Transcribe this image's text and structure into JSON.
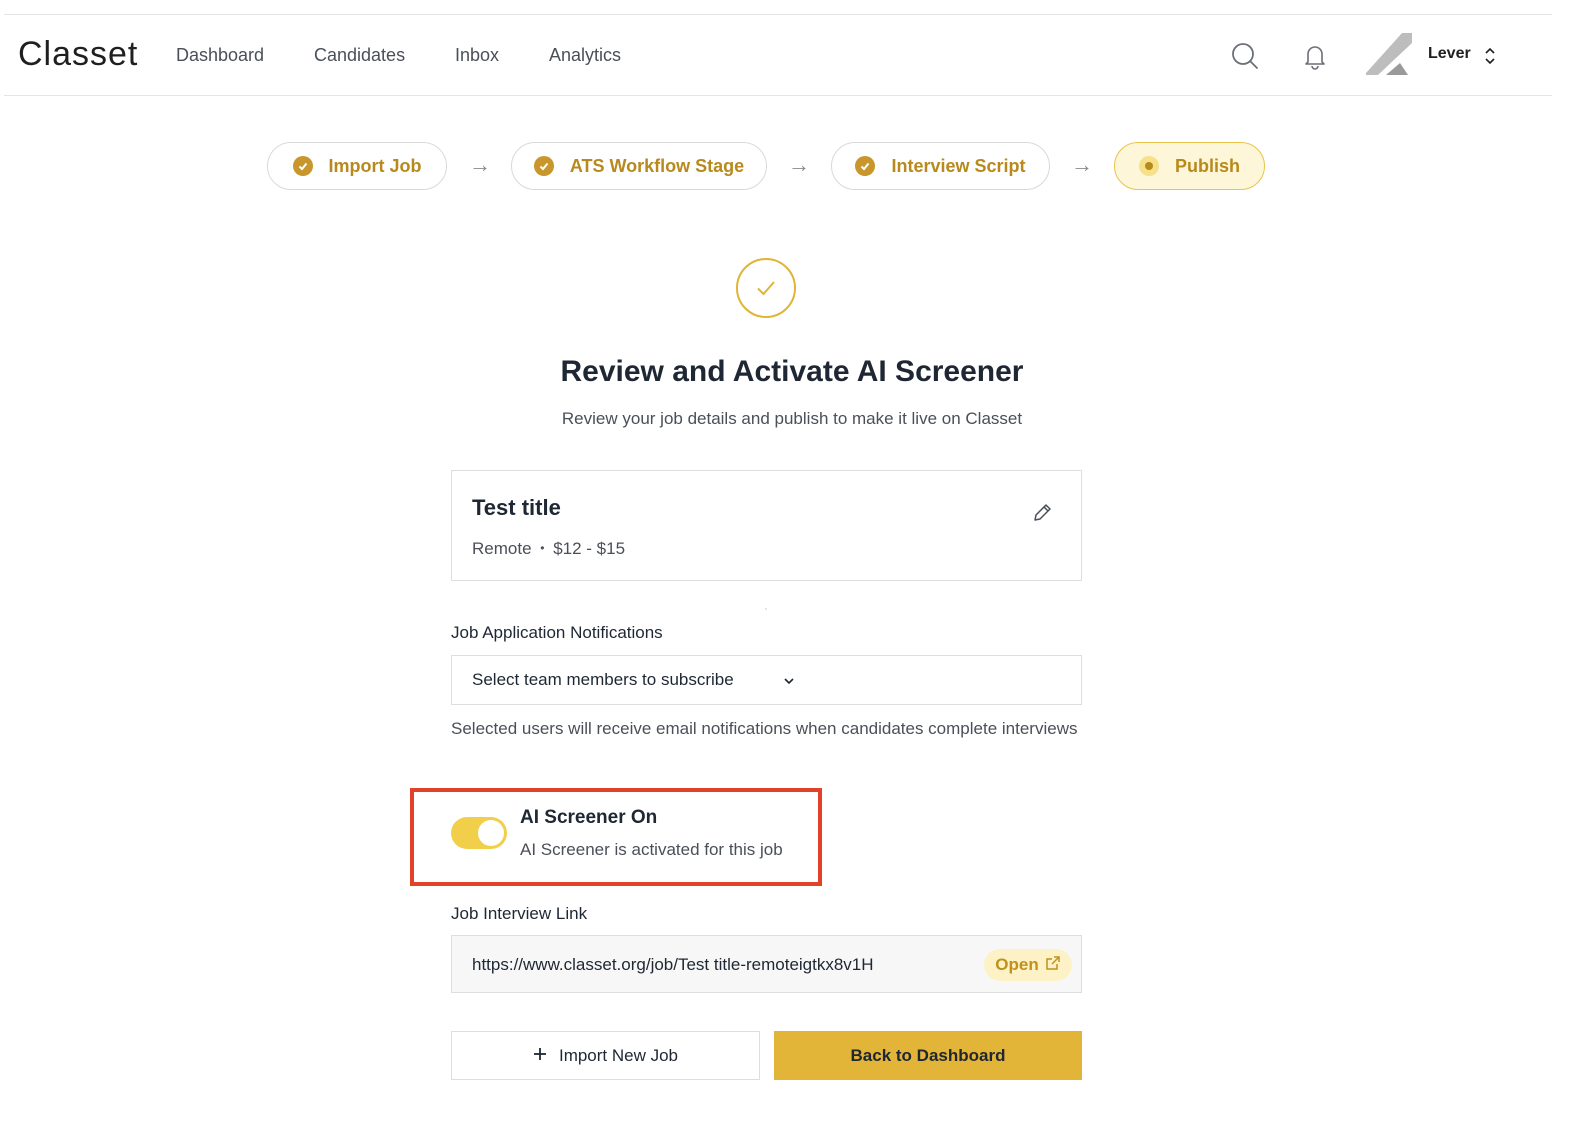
{
  "brand": {
    "logo_text": "Classet"
  },
  "nav": {
    "items": [
      {
        "label": "Dashboard"
      },
      {
        "label": "Candidates"
      },
      {
        "label": "Inbox"
      },
      {
        "label": "Analytics"
      }
    ],
    "icons": {
      "search": "search-icon",
      "notifications": "bell-icon",
      "avatar": "avatar"
    },
    "account_label": "Lever"
  },
  "stepper": {
    "steps": [
      {
        "label": "Import Job",
        "state": "complete"
      },
      {
        "label": "ATS Workflow Stage",
        "state": "complete"
      },
      {
        "label": "Interview Script",
        "state": "complete"
      },
      {
        "label": "Publish",
        "state": "current"
      }
    ]
  },
  "hero": {
    "title": "Review and Activate AI Screener",
    "subtitle": "Review your job details and publish to make it live on Classet"
  },
  "job": {
    "title": "Test title",
    "location": "Remote",
    "separator": "•",
    "pay": "$12 - $15"
  },
  "notifications": {
    "label": "Job Application Notifications",
    "select_placeholder": "Select team members to subscribe",
    "helper": "Selected users will receive email notifications when candidates complete interviews"
  },
  "screener": {
    "enabled": true,
    "title": "AI Screener On",
    "description": "AI Screener is activated for this job"
  },
  "interview_link": {
    "label": "Job Interview Link",
    "url": "https://www.classet.org/job/Test title-remoteigtkx8v1H",
    "open_label": "Open"
  },
  "actions": {
    "import_label": "Import New Job",
    "back_label": "Back to Dashboard"
  },
  "colors": {
    "accent": "#e2b437",
    "accent_text": "#b8891c",
    "highlight": "#e0422a"
  }
}
